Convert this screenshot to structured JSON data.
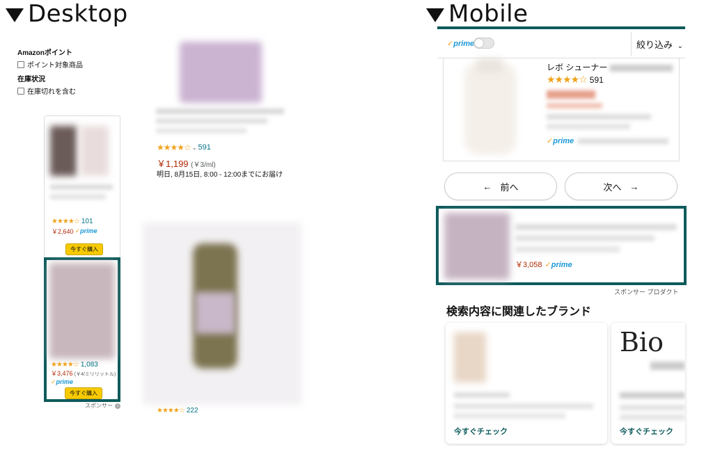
{
  "headings": {
    "desktop": "Desktop",
    "mobile": "Mobile"
  },
  "desktop": {
    "filters": [
      {
        "head": "Amazonポイント",
        "option": "ポイント対象商品"
      },
      {
        "head": "在庫状況",
        "option": "在庫切れを含む"
      }
    ],
    "sponsored_cards": [
      {
        "stars": "★★★★☆",
        "count": "101",
        "price": "￥2,640",
        "prime": "prime",
        "buy": "今すぐ購入"
      },
      {
        "stars": "★★★★☆",
        "count": "1,083",
        "price": "￥3,476",
        "unit": "(￥4/ミリリットル)",
        "prime": "prime",
        "buy": "今すぐ購入"
      }
    ],
    "sponsor_label": "スポンサー",
    "main_result": {
      "stars": "★★★★☆",
      "count": "591",
      "price": "￥1,199",
      "unit": "(￥3/ml)",
      "delivery": "明日, 8月15日, 8:00 - 12:00までにお届け"
    },
    "second_result": {
      "stars": "★★★★☆",
      "count": "222"
    }
  },
  "mobile": {
    "prime_label": "prime",
    "filter_label": "絞り込み",
    "product": {
      "name": "レボ シューナー",
      "stars": "★★★★☆",
      "count": "591",
      "prime": "prime"
    },
    "prev": "前へ",
    "next": "次へ",
    "sponsored": {
      "price": "￥3,058",
      "prime": "prime"
    },
    "sponsor_product_label": "スポンサー プロダクト",
    "brands_title": "検索内容に関連したブランド",
    "brand_cards": [
      {
        "name": "",
        "check": "今すぐチェック"
      },
      {
        "name": "Bio",
        "check": "今すぐチェック"
      }
    ]
  },
  "colors": {
    "teal": "#0f5b5c",
    "star": "#f0a21b",
    "price": "#b12704",
    "prime": "#1a98d6"
  }
}
